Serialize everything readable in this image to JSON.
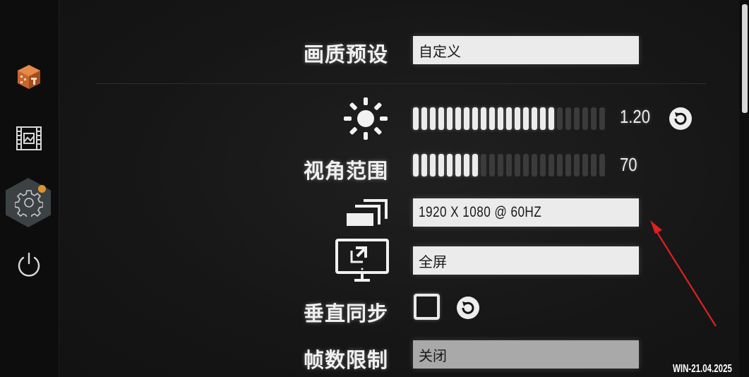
{
  "sidebar": {
    "items": [
      {
        "name": "store-cube-icon"
      },
      {
        "name": "film-icon"
      },
      {
        "name": "settings-gear-icon",
        "active": true,
        "has_notification": true
      },
      {
        "name": "power-icon"
      }
    ]
  },
  "settings": {
    "quality_preset": {
      "label": "画质预设",
      "value": "自定义"
    },
    "brightness": {
      "icon": "sun-icon",
      "value": "1.20",
      "filled_segments": 17,
      "total_segments": 23
    },
    "fov": {
      "label": "视角范围",
      "value": "70",
      "filled_segments": 8,
      "total_segments": 23
    },
    "resolution": {
      "icon": "resolution-icon",
      "value": "1920 X 1080 @ 60HZ"
    },
    "display_mode": {
      "icon": "monitor-icon",
      "value": "全屏"
    },
    "vsync": {
      "label": "垂直同步",
      "checked": false
    },
    "frame_limit": {
      "label": "帧数限制",
      "value": "关闭"
    }
  },
  "build": "WIN-21.04.2025",
  "colors": {
    "background": "#151515",
    "sidebar": "#0d0d0d",
    "accent_dot": "#e0932d",
    "field": "#ebebeb",
    "arrow": "#e02020"
  }
}
